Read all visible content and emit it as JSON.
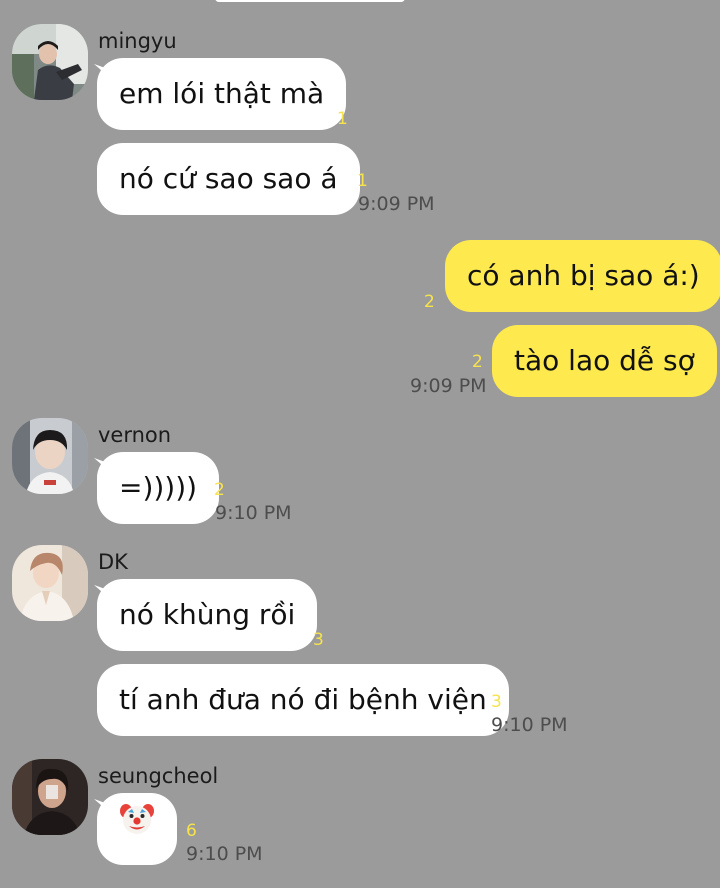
{
  "colors": {
    "background": "#9b9b9b",
    "incoming_bubble": "#ffffff",
    "outgoing_bubble": "#fee94e",
    "unread_count": "#f7e34b",
    "timestamp": "#4d4d4d"
  },
  "messages": {
    "mingyu": {
      "sender": "mingyu",
      "m1_text": "em lói thật mà",
      "m1_count": "1",
      "m2_text": "nó cứ sao sao á",
      "m2_count": "1",
      "time": "9:09 PM"
    },
    "me": {
      "m1_text": "có anh bị sao á:)",
      "m1_count": "2",
      "m2_text": "tào lao dễ sợ",
      "m2_count": "2",
      "time": "9:09 PM"
    },
    "vernon": {
      "sender": "vernon",
      "m1_text": "=)))))",
      "m1_count": "2",
      "time": "9:10 PM"
    },
    "dk": {
      "sender": "DK",
      "m1_text": "nó khùng rồi",
      "m1_count": "3",
      "m2_text": "tí anh đưa nó đi bệnh viện",
      "m2_count": "3",
      "time": "9:10 PM"
    },
    "seungcheol": {
      "sender": "seungcheol",
      "emoji_name": "clown-face-icon",
      "m1_count": "6",
      "time": "9:10 PM"
    }
  }
}
